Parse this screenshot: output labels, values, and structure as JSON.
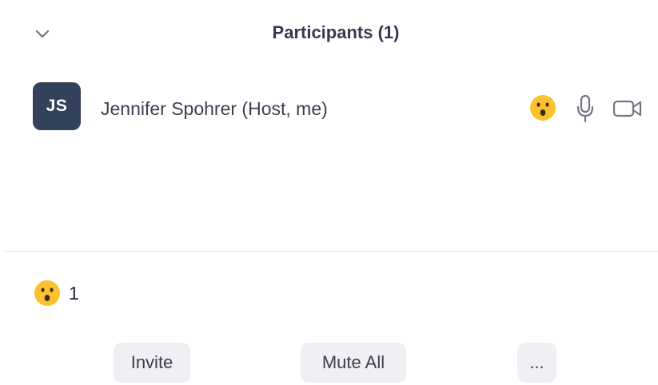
{
  "header": {
    "title": "Participants (1)",
    "collapse_icon": "chevron-down-icon"
  },
  "participants": [
    {
      "initials": "JS",
      "name": "Jennifer Spohrer (Host, me)",
      "avatar_color": "#32425a",
      "reaction_icon": "surprised-emoji-icon",
      "mic_icon": "microphone-icon",
      "video_icon": "video-camera-icon"
    }
  ],
  "reactions_summary": {
    "icon": "surprised-emoji-icon",
    "count": "1"
  },
  "footer": {
    "invite_label": "Invite",
    "mute_all_label": "Mute All",
    "more_label": "..."
  },
  "colors": {
    "emoji_yellow": "#f9c22e",
    "button_bg": "#efeff4",
    "title_text": "#39394d"
  }
}
